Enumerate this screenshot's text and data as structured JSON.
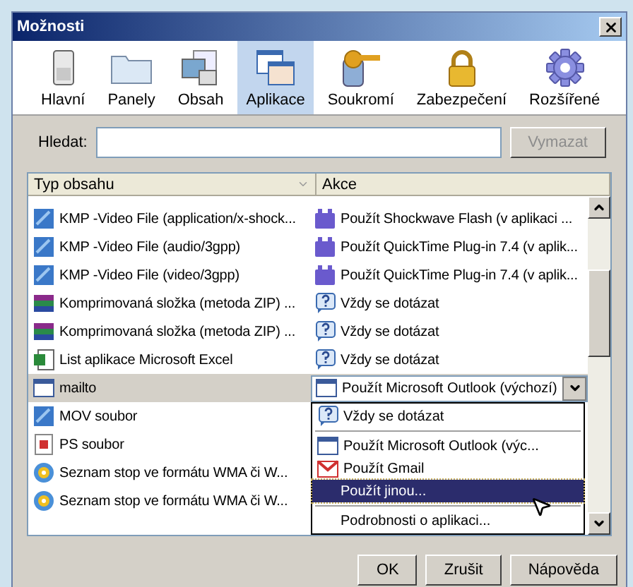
{
  "window": {
    "title": "Možnosti"
  },
  "toolbar": [
    {
      "label": "Hlavní",
      "kind": "switch",
      "selected": false
    },
    {
      "label": "Panely",
      "kind": "folder",
      "selected": false
    },
    {
      "label": "Obsah",
      "kind": "pictures",
      "selected": false
    },
    {
      "label": "Aplikace",
      "kind": "windows",
      "selected": true
    },
    {
      "label": "Soukromí",
      "kind": "hanger",
      "selected": false
    },
    {
      "label": "Zabezpečení",
      "kind": "lock",
      "selected": false
    },
    {
      "label": "Rozšířené",
      "kind": "gear",
      "selected": false
    }
  ],
  "search": {
    "label": "Hledat:",
    "button": "Vymazat",
    "button_disabled": true
  },
  "table": {
    "columns": [
      "Typ obsahu",
      "Akce"
    ],
    "rows": [
      {
        "type": {
          "kind": "video",
          "text": "KMP -Video File (application/x-shock..."
        },
        "action": {
          "kind": "plugin",
          "text": "Použít Shockwave Flash (v aplikaci ..."
        },
        "selected": false
      },
      {
        "type": {
          "kind": "video",
          "text": "KMP -Video File (audio/3gpp)"
        },
        "action": {
          "kind": "plugin",
          "text": "Použít QuickTime Plug-in 7.4 (v aplik..."
        },
        "selected": false
      },
      {
        "type": {
          "kind": "video",
          "text": "KMP -Video File (video/3gpp)"
        },
        "action": {
          "kind": "plugin",
          "text": "Použít QuickTime Plug-in 7.4 (v aplik..."
        },
        "selected": false
      },
      {
        "type": {
          "kind": "archive",
          "text": "Komprimovaná složka (metoda ZIP) ..."
        },
        "action": {
          "kind": "ask",
          "text": "Vždy se dotázat"
        },
        "selected": false
      },
      {
        "type": {
          "kind": "archive",
          "text": "Komprimovaná složka (metoda ZIP) ..."
        },
        "action": {
          "kind": "ask",
          "text": "Vždy se dotázat"
        },
        "selected": false
      },
      {
        "type": {
          "kind": "spreadsheet",
          "text": "List aplikace Microsoft Excel"
        },
        "action": {
          "kind": "ask",
          "text": "Vždy se dotázat"
        },
        "selected": false
      },
      {
        "type": {
          "kind": "window",
          "text": "mailto"
        },
        "action": {
          "kind": "combo",
          "text": "Použít Microsoft Outlook (výchozí)"
        },
        "selected": true
      },
      {
        "type": {
          "kind": "video",
          "text": "MOV soubor"
        },
        "selected": false
      },
      {
        "type": {
          "kind": "document",
          "text": "PS soubor"
        },
        "selected": false
      },
      {
        "type": {
          "kind": "media",
          "text": "Seznam stop ve formátu WMA či W..."
        },
        "selected": false
      },
      {
        "type": {
          "kind": "media",
          "text": "Seznam stop ve formátu WMA či W..."
        },
        "selected": false
      }
    ]
  },
  "dropdown": [
    {
      "kind": "ask",
      "label": "Vždy se dotázat",
      "selected": false
    },
    {
      "kind": "separator"
    },
    {
      "kind": "window",
      "label": "Použít Microsoft Outlook (výc...",
      "selected": false
    },
    {
      "kind": "mail",
      "label": "Použít Gmail",
      "selected": false
    },
    {
      "kind": "plain",
      "label": "Použít jinou...",
      "selected": true
    },
    {
      "kind": "separator"
    },
    {
      "kind": "plain",
      "label": "Podrobnosti o aplikaci...",
      "selected": false
    }
  ],
  "buttons": [
    "OK",
    "Zrušit",
    "Nápověda"
  ]
}
